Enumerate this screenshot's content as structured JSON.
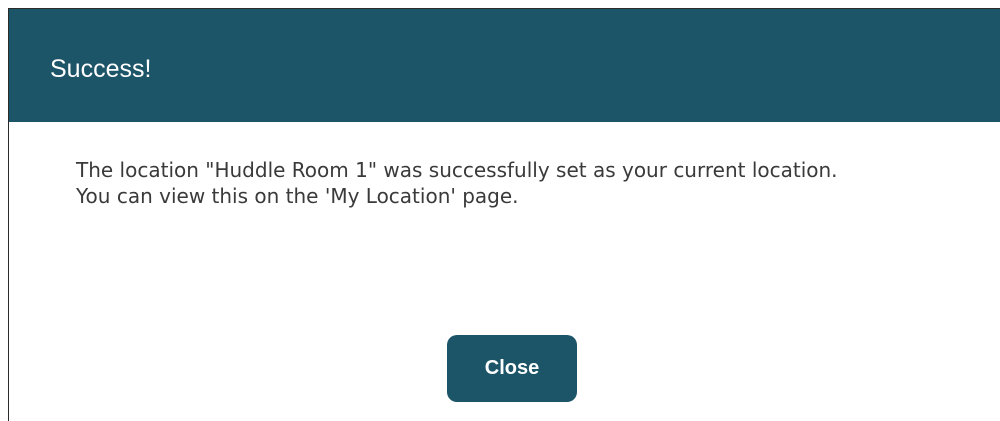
{
  "dialog": {
    "title": "Success!",
    "message": "The location \"Huddle Room 1\" was successfully set as your current location. You can view this on the 'My Location' page.",
    "close_label": "Close"
  },
  "colors": {
    "header_bg": "#1c5468",
    "button_bg": "#1c5468",
    "title_text": "#ffffff",
    "body_text": "#3a3a3a"
  }
}
